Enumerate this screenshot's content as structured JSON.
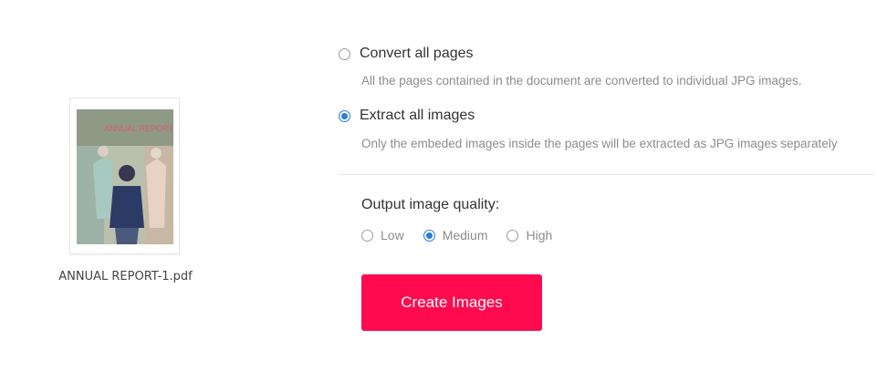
{
  "file": {
    "name": "ANNUAL REPORT-1.pdf",
    "thumbnail_title": "ANNUAL REPORT 2016"
  },
  "options": [
    {
      "label": "Convert all pages",
      "description": "All the pages contained in the document are converted to individual JPG images.",
      "selected": false
    },
    {
      "label": "Extract all images",
      "description": "Only the embeded images inside the pages  will be extracted as JPG images separately",
      "selected": true
    }
  ],
  "quality": {
    "label": "Output image quality:",
    "choices": [
      "Low",
      "Medium",
      "High"
    ],
    "selected": "Medium"
  },
  "create_button": {
    "label": "Create Images"
  },
  "colors": {
    "accent_button": "#ff0a4f",
    "radio_selected": "#2b7bd9",
    "secondary_text": "#8c8c8c"
  }
}
